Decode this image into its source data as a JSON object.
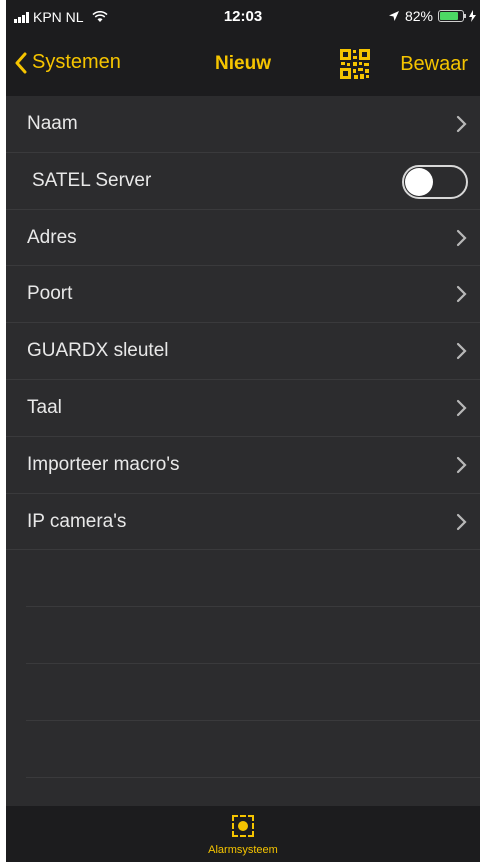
{
  "status_bar": {
    "carrier": "KPN NL",
    "time": "12:03",
    "battery_percent": "82%",
    "battery_level": 0.82
  },
  "nav": {
    "back_label": "Systemen",
    "title": "Nieuw",
    "save_label": "Bewaar"
  },
  "rows": [
    {
      "label": "Naam",
      "type": "disclosure"
    },
    {
      "label": "SATEL Server",
      "type": "toggle",
      "value": false
    },
    {
      "label": "Adres",
      "type": "disclosure"
    },
    {
      "label": "Poort",
      "type": "disclosure"
    },
    {
      "label": "GUARDX sleutel",
      "type": "disclosure"
    },
    {
      "label": "Taal",
      "type": "disclosure"
    },
    {
      "label": "Importeer macro's",
      "type": "disclosure"
    },
    {
      "label": "IP camera's",
      "type": "disclosure"
    }
  ],
  "tab_bar": {
    "label": "Alarmsysteem"
  },
  "colors": {
    "accent": "#f5c400",
    "background": "#2c2c2e",
    "bar_background": "#1c1c1e"
  }
}
